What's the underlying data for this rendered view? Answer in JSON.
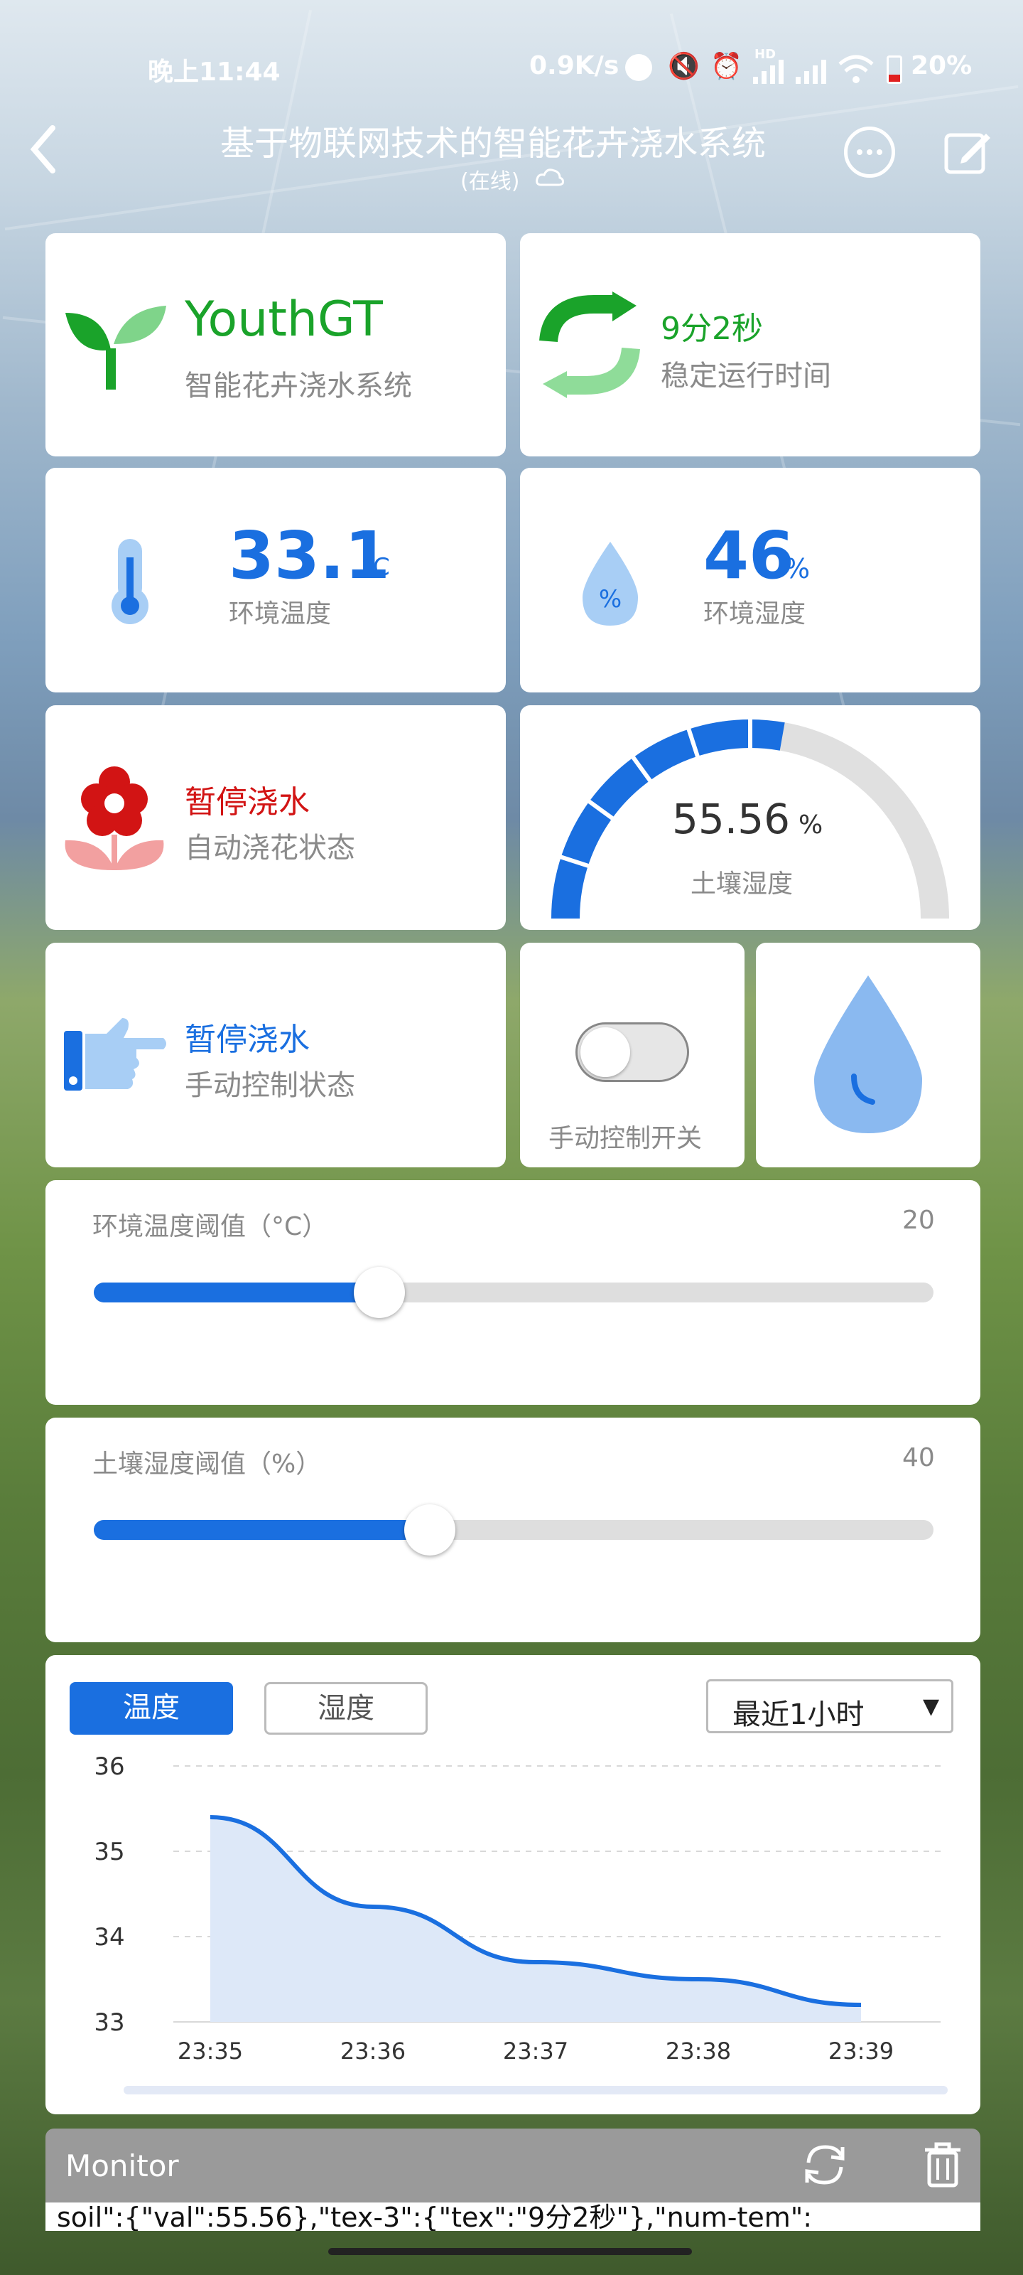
{
  "status": {
    "time": "晚上11:44",
    "speed": "0.9K/s",
    "hd": "HD",
    "battery": "20%"
  },
  "header": {
    "title": "基于物联网技术的智能花卉浇水系统",
    "subtitle": "(在线)"
  },
  "brand": {
    "name": "YouthGT",
    "desc": "智能花卉浇水系统"
  },
  "uptime": {
    "value": "9分2秒",
    "label": "稳定运行时间"
  },
  "temperature": {
    "value": "33.1",
    "unit": "°C",
    "label": "环境温度"
  },
  "humidity": {
    "value": "46",
    "unit": "%",
    "label": "环境湿度"
  },
  "auto": {
    "status": "暂停浇水",
    "label": "自动浇花状态"
  },
  "soil": {
    "value": "55.56",
    "unit": "%",
    "label": "土壤湿度",
    "level": 0.5556
  },
  "manual": {
    "status": "暂停浇水",
    "label": "手动控制状态"
  },
  "switch": {
    "label": "手动控制开关",
    "on": false
  },
  "temp_threshold": {
    "label": "环境温度阈值（°C）",
    "value": "20",
    "fraction": 0.34
  },
  "soil_threshold": {
    "label": "土壤湿度阈值（%）",
    "value": "40",
    "fraction": 0.4
  },
  "chart_tabs": {
    "temp": "温度",
    "hum": "湿度",
    "range": "最近1小时"
  },
  "chart_data": {
    "type": "area",
    "x": [
      "23:35",
      "23:36",
      "23:37",
      "23:38",
      "23:39"
    ],
    "series": [
      {
        "values": [
          35.4,
          34.35,
          33.7,
          33.5,
          33.2
        ]
      }
    ],
    "ylim": [
      33,
      36
    ],
    "yticks": [
      "33",
      "34",
      "35",
      "36"
    ],
    "grid": true
  },
  "monitor": {
    "title": "Monitor",
    "log": "soil\":{\"val\":55.56},\"tex-3\":{\"tex\":\"9分2秒\"},\"num-tem\":"
  },
  "colors": {
    "accent": "#1a6fe0",
    "green": "#1aa32a",
    "red": "#d21414"
  }
}
